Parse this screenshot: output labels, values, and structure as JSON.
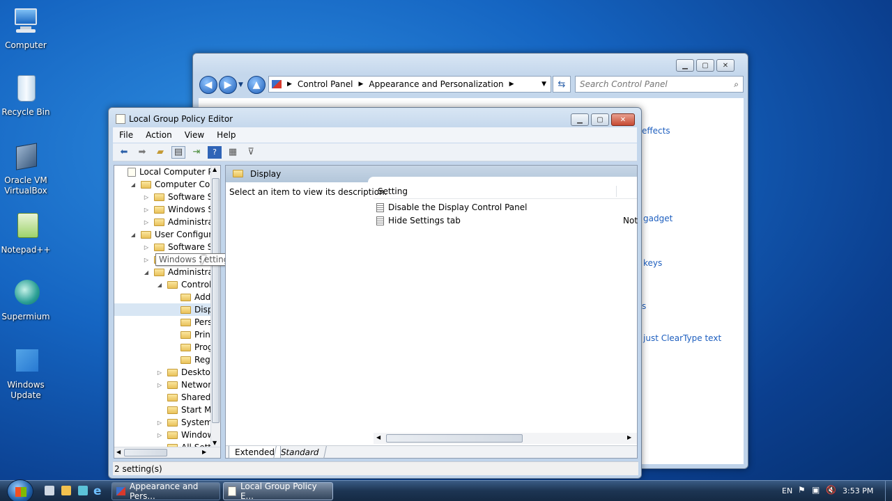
{
  "desktop": {
    "icons": [
      {
        "label": "Computer"
      },
      {
        "label": "Recycle Bin"
      },
      {
        "label1": "Oracle VM",
        "label2": "VirtualBox"
      },
      {
        "label": "Notepad++"
      },
      {
        "label": "Supermium"
      },
      {
        "label1": "Windows",
        "label2": "Update"
      }
    ]
  },
  "control_panel": {
    "breadcrumb": [
      "Control Panel",
      "Appearance and Personalization"
    ],
    "search_placeholder": "Search Control Panel",
    "visible_links": [
      "effects",
      "gadget",
      "keys",
      "s",
      "just ClearType text"
    ]
  },
  "gpe": {
    "title": "Local Group Policy Editor",
    "menu": [
      "File",
      "Action",
      "View",
      "Help"
    ],
    "tree": [
      {
        "label": "Local Computer Polic",
        "indent": 0,
        "exp": ""
      },
      {
        "label": "Computer Config",
        "indent": 1,
        "exp": "◢"
      },
      {
        "label": "Software Setti",
        "indent": 2,
        "exp": "▷"
      },
      {
        "label": "Windows Sett",
        "indent": 2,
        "exp": "▷"
      },
      {
        "label": "Administrative",
        "indent": 2,
        "exp": "▷"
      },
      {
        "label": "User Configuratio",
        "indent": 1,
        "exp": "◢"
      },
      {
        "label": "Software Setti",
        "indent": 2,
        "exp": "▷"
      },
      {
        "label": "Windows Settings",
        "indent": 2,
        "exp": "▷"
      },
      {
        "label": "Administrative",
        "indent": 2,
        "exp": "◢"
      },
      {
        "label": "Control Pa",
        "indent": 3,
        "exp": "◢"
      },
      {
        "label": "Add or",
        "indent": 4,
        "exp": ""
      },
      {
        "label": "Display",
        "indent": 4,
        "exp": ""
      },
      {
        "label": "Person",
        "indent": 4,
        "exp": ""
      },
      {
        "label": "Printer",
        "indent": 4,
        "exp": ""
      },
      {
        "label": "Progra",
        "indent": 4,
        "exp": ""
      },
      {
        "label": "Region",
        "indent": 4,
        "exp": ""
      },
      {
        "label": "Desktop",
        "indent": 3,
        "exp": "▷"
      },
      {
        "label": "Network",
        "indent": 3,
        "exp": "▷"
      },
      {
        "label": "Shared Fol",
        "indent": 3,
        "exp": ""
      },
      {
        "label": "Start Menu",
        "indent": 3,
        "exp": ""
      },
      {
        "label": "System",
        "indent": 3,
        "exp": "▷"
      },
      {
        "label": "Windows",
        "indent": 3,
        "exp": "▷"
      },
      {
        "label": "All Setti",
        "indent": 3,
        "exp": ""
      }
    ],
    "tooltip": "Windows Settings",
    "pane_header": "Display",
    "description": "Select an item to view its description.",
    "column_setting": "Setting",
    "settings": [
      {
        "name": "Disable the Display Control Panel",
        "state": ""
      },
      {
        "name": "Hide Settings tab",
        "state": "Not"
      }
    ],
    "tabs": [
      "Extended",
      "Standard"
    ],
    "status": "2 setting(s)"
  },
  "taskbar": {
    "buttons": [
      "Appearance and Pers...",
      "Local Group Policy E..."
    ],
    "lang": "EN",
    "time": "3:53 PM"
  }
}
